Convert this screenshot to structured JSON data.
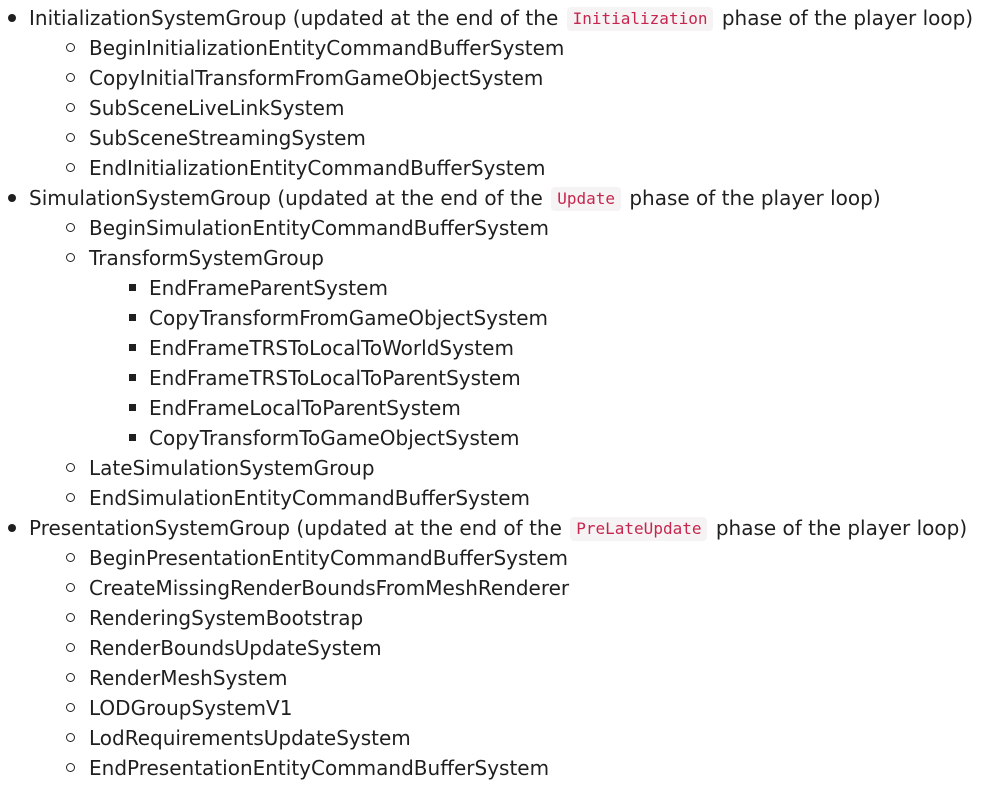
{
  "groups": [
    {
      "name": "InitializationSystemGroup",
      "desc_before": " (updated at the end of the ",
      "phase": "Initialization",
      "desc_after": " phase of the player loop)",
      "children": [
        "BeginInitializationEntityCommandBufferSystem",
        "CopyInitialTransformFromGameObjectSystem",
        "SubSceneLiveLinkSystem",
        "SubSceneStreamingSystem",
        "EndInitializationEntityCommandBufferSystem"
      ]
    },
    {
      "name": "SimulationSystemGroup",
      "desc_before": " (updated at the end of the ",
      "phase": "Update",
      "desc_after": " phase of the player loop)",
      "children": [
        "BeginSimulationEntityCommandBufferSystem",
        "TransformSystemGroup",
        "LateSimulationSystemGroup",
        "EndSimulationEntityCommandBufferSystem"
      ],
      "transform_children": [
        "EndFrameParentSystem",
        "CopyTransformFromGameObjectSystem",
        "EndFrameTRSToLocalToWorldSystem",
        "EndFrameTRSToLocalToParentSystem",
        "EndFrameLocalToParentSystem",
        "CopyTransformToGameObjectSystem"
      ]
    },
    {
      "name": "PresentationSystemGroup",
      "desc_before": " (updated at the end of the ",
      "phase": "PreLateUpdate",
      "desc_after": " phase of the player loop)",
      "children": [
        "BeginPresentationEntityCommandBufferSystem",
        "CreateMissingRenderBoundsFromMeshRenderer",
        "RenderingSystemBootstrap",
        "RenderBoundsUpdateSystem",
        "RenderMeshSystem",
        "LODGroupSystemV1",
        "LodRequirementsUpdateSystem",
        "EndPresentationEntityCommandBufferSystem"
      ]
    }
  ],
  "colors": {
    "text": "#1f1f1f",
    "code_text": "#c7254e",
    "code_bg": "#f6f3f4"
  }
}
